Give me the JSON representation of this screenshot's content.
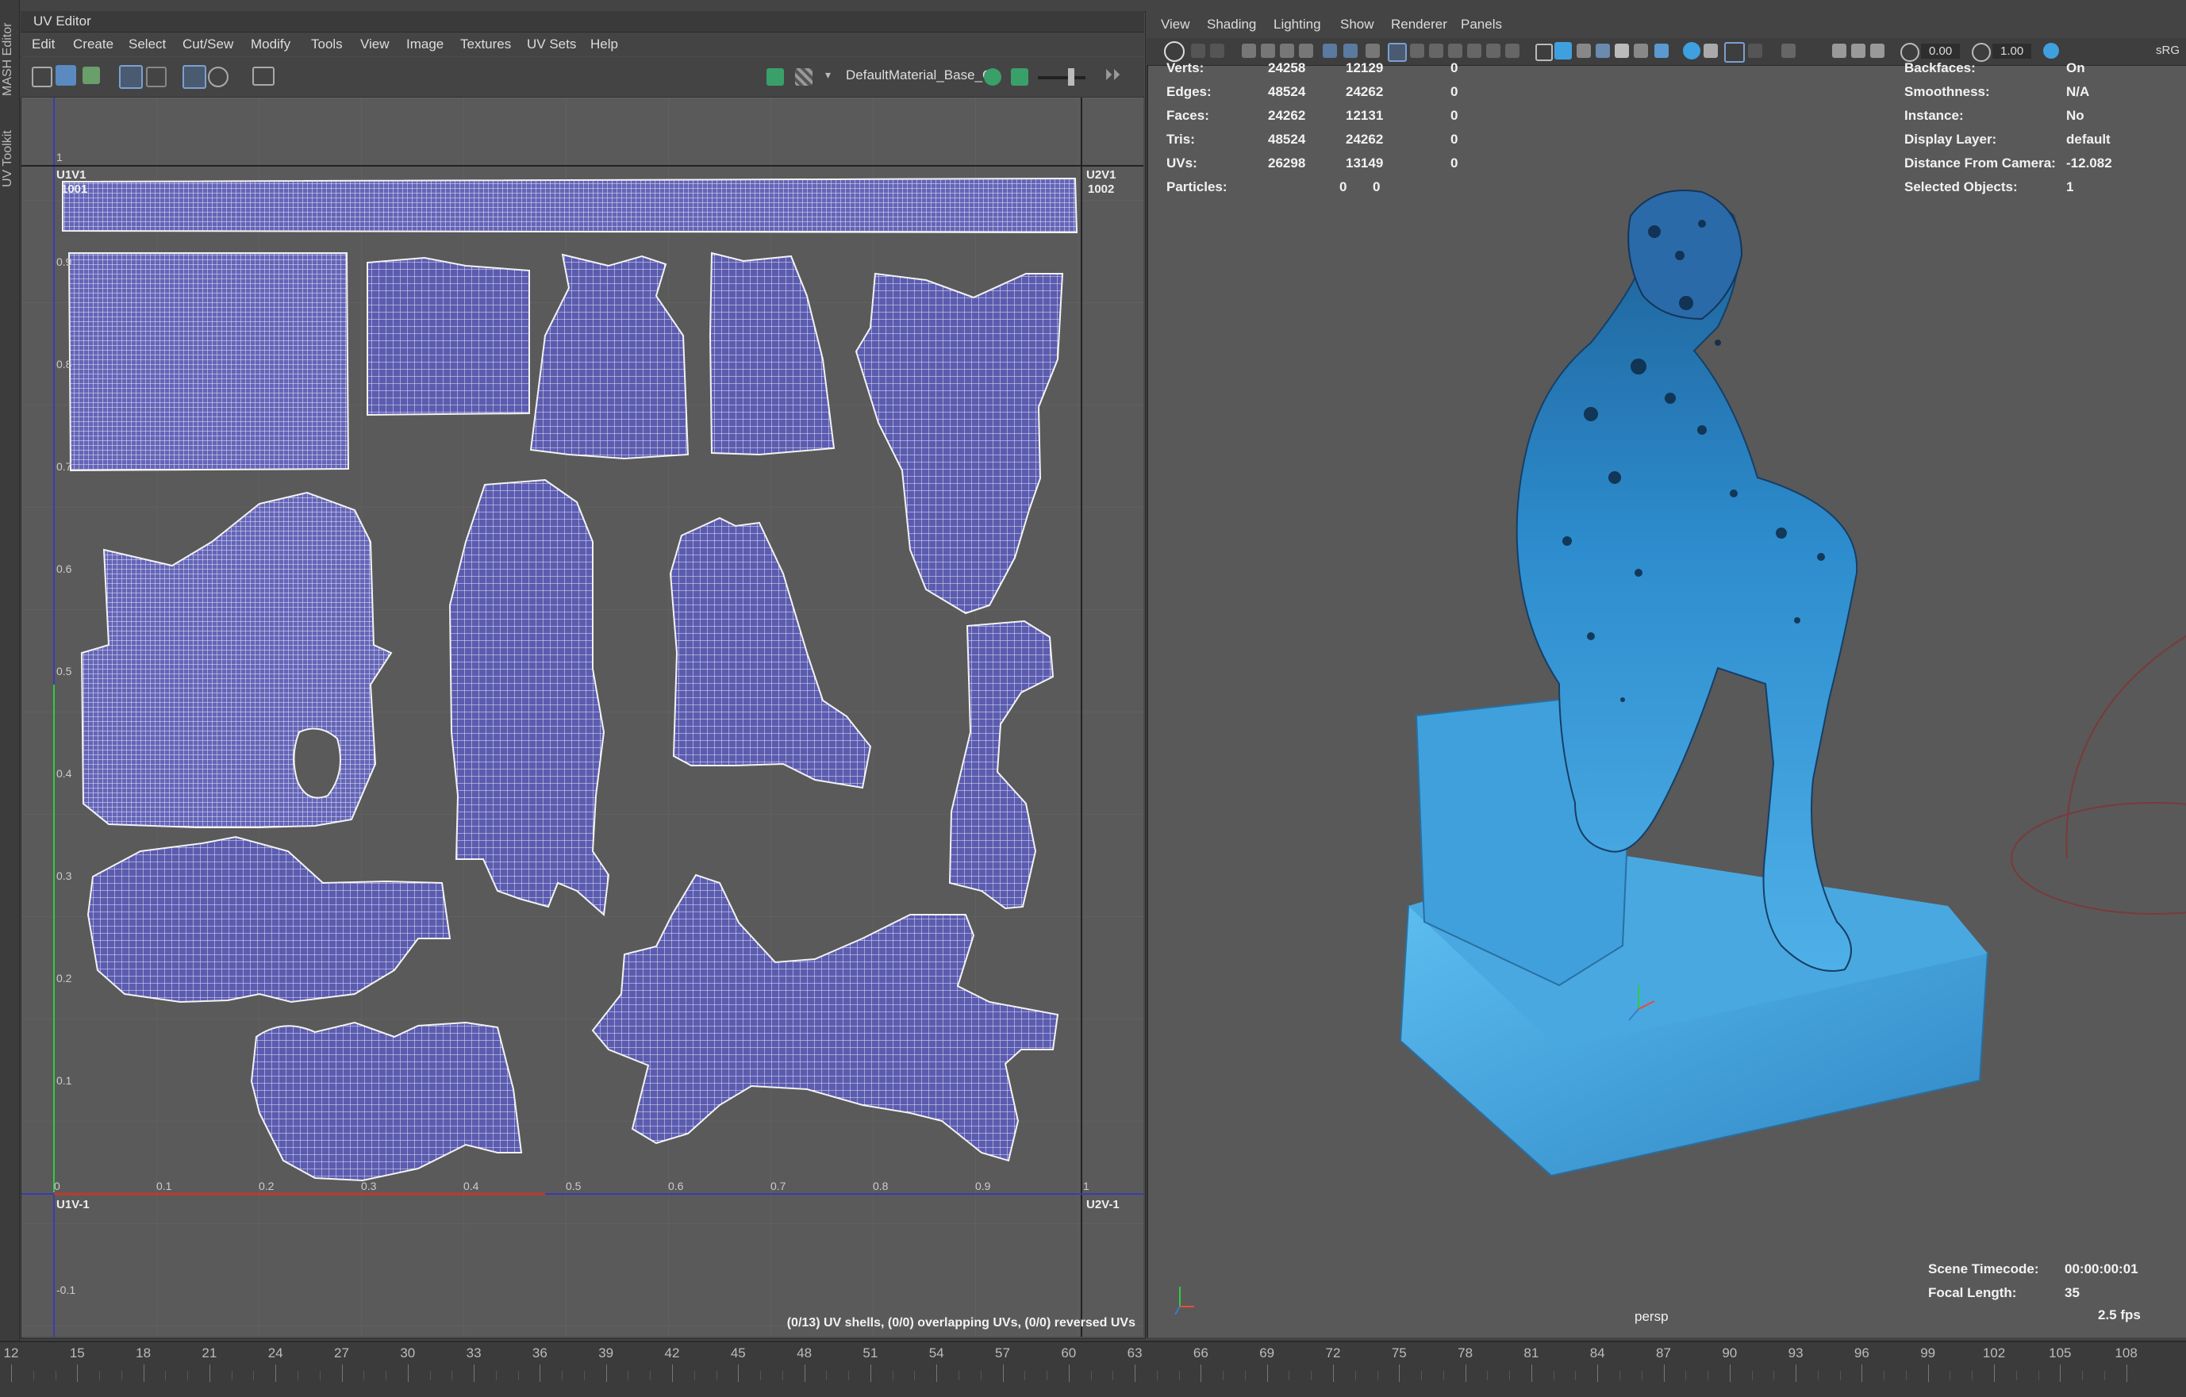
{
  "side_tabs": [
    "MASH Editor",
    "UV Toolkit"
  ],
  "uv_editor": {
    "title": "UV Editor",
    "menu": [
      "Edit",
      "Create",
      "Select",
      "Cut/Sew",
      "Modify",
      "Tools",
      "View",
      "Image",
      "Textures",
      "UV Sets",
      "Help"
    ],
    "material": "DefaultMaterial_Base_C",
    "tiles": {
      "u1v1": "U1V1",
      "u1v1_num": "1001",
      "u2v1": "U2V1",
      "u2v1_num": "1002",
      "u1v_1": "U1V-1",
      "u2v_1": "U2V-1"
    },
    "u_ticks": [
      "0",
      "0.1",
      "0.2",
      "0.3",
      "0.4",
      "0.5",
      "0.6",
      "0.7",
      "0.8",
      "0.9",
      "1"
    ],
    "v_ticks": [
      "1",
      "0.9",
      "0.8",
      "0.7",
      "0.6",
      "0.5",
      "0.4",
      "0.3",
      "0.2",
      "0.1",
      "-0.1"
    ],
    "status": "(0/13) UV shells, (0/0) overlapping UVs, (0/0) reversed UVs"
  },
  "viewport": {
    "menu": [
      "View",
      "Shading",
      "Lighting",
      "Show",
      "Renderer",
      "Panels"
    ],
    "field_a": "0.00",
    "field_b": "1.00",
    "color_space": "sRG",
    "stats": [
      {
        "label": "Verts:",
        "a": "24258",
        "b": "12129",
        "c": "0"
      },
      {
        "label": "Edges:",
        "a": "48524",
        "b": "24262",
        "c": "0"
      },
      {
        "label": "Faces:",
        "a": "24262",
        "b": "12131",
        "c": "0"
      },
      {
        "label": "Tris:",
        "a": "48524",
        "b": "24262",
        "c": "0"
      },
      {
        "label": "UVs:",
        "a": "26298",
        "b": "13149",
        "c": "0"
      },
      {
        "label": "Particles:",
        "a": "0",
        "b": "0",
        "c": ""
      }
    ],
    "props": [
      {
        "label": "Backfaces:",
        "value": "On"
      },
      {
        "label": "Smoothness:",
        "value": "N/A"
      },
      {
        "label": "Instance:",
        "value": "No"
      },
      {
        "label": "Display Layer:",
        "value": "default"
      },
      {
        "label": "Distance From Camera:",
        "value": "-12.082"
      },
      {
        "label": "Selected Objects:",
        "value": "1"
      }
    ],
    "camera": "persp",
    "timecode_label": "Scene Timecode:",
    "timecode": "00:00:00:01",
    "focal_label": "Focal Length:",
    "focal": "35",
    "fps": "2.5 fps"
  },
  "timeline": {
    "labels": [
      "12",
      "15",
      "18",
      "21",
      "24",
      "27",
      "30",
      "33",
      "36",
      "39",
      "42",
      "45",
      "48",
      "51",
      "54",
      "57",
      "60",
      "63",
      "66",
      "69",
      "72",
      "75",
      "78",
      "81",
      "84",
      "87",
      "90",
      "93",
      "96",
      "99",
      "102",
      "105",
      "108"
    ]
  },
  "colors": {
    "uv_fill": "#5b5cb0",
    "statue_blue": "#2f8fd0",
    "u_axis": "#c0392b",
    "v_axis": "#2ecc40"
  }
}
